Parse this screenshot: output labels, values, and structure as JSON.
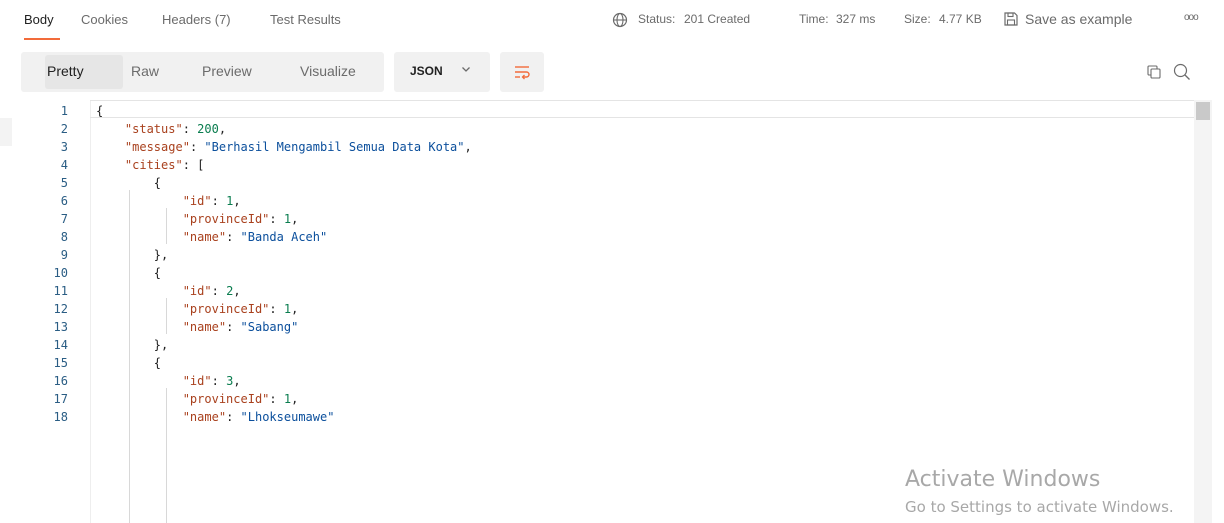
{
  "tabs": [
    {
      "label": "Body"
    },
    {
      "label": "Cookies"
    },
    {
      "label": "Headers (7)"
    },
    {
      "label": "Test Results"
    }
  ],
  "response_meta": {
    "status_label": "Status:",
    "status_value": "201 Created",
    "time_label": "Time:",
    "time_value": "327 ms",
    "size_label": "Size:",
    "size_value": "4.77 KB",
    "save_example": "Save as example",
    "more": "ooo"
  },
  "view_tabs": [
    {
      "label": "Pretty"
    },
    {
      "label": "Raw"
    },
    {
      "label": "Preview"
    },
    {
      "label": "Visualize"
    }
  ],
  "format_select": {
    "value": "JSON"
  },
  "icons": {
    "globe": "globe-icon",
    "save": "save-icon",
    "wrap": "wrap-lines-icon",
    "copy": "copy-icon",
    "search": "search-icon",
    "chevron": "chevron-down-icon"
  },
  "colors": {
    "accent": "#f26b3a",
    "status_ok": "#0a7d4f",
    "json_key": "#a9411e",
    "json_string": "#0b4f9c",
    "json_number": "#0a7d4f"
  },
  "code_lines": [
    {
      "num": "1",
      "text": "{"
    },
    {
      "num": "2",
      "text": "    \"status\": 200,"
    },
    {
      "num": "3",
      "text": "    \"message\": \"Berhasil Mengambil Semua Data Kota\","
    },
    {
      "num": "4",
      "text": "    \"cities\": ["
    },
    {
      "num": "5",
      "text": "        {"
    },
    {
      "num": "6",
      "text": "            \"id\": 1,"
    },
    {
      "num": "7",
      "text": "            \"provinceId\": 1,"
    },
    {
      "num": "8",
      "text": "            \"name\": \"Banda Aceh\""
    },
    {
      "num": "9",
      "text": "        },"
    },
    {
      "num": "10",
      "text": "        {"
    },
    {
      "num": "11",
      "text": "            \"id\": 2,"
    },
    {
      "num": "12",
      "text": "            \"provinceId\": 1,"
    },
    {
      "num": "13",
      "text": "            \"name\": \"Sabang\""
    },
    {
      "num": "14",
      "text": "        },"
    },
    {
      "num": "15",
      "text": "        {"
    },
    {
      "num": "16",
      "text": "            \"id\": 3,"
    },
    {
      "num": "17",
      "text": "            \"provinceId\": 1,"
    },
    {
      "num": "18",
      "text": "            \"name\": \"Lhokseumawe\""
    }
  ],
  "watermark": {
    "title": "Activate Windows",
    "subtitle": "Go to Settings to activate Windows."
  }
}
